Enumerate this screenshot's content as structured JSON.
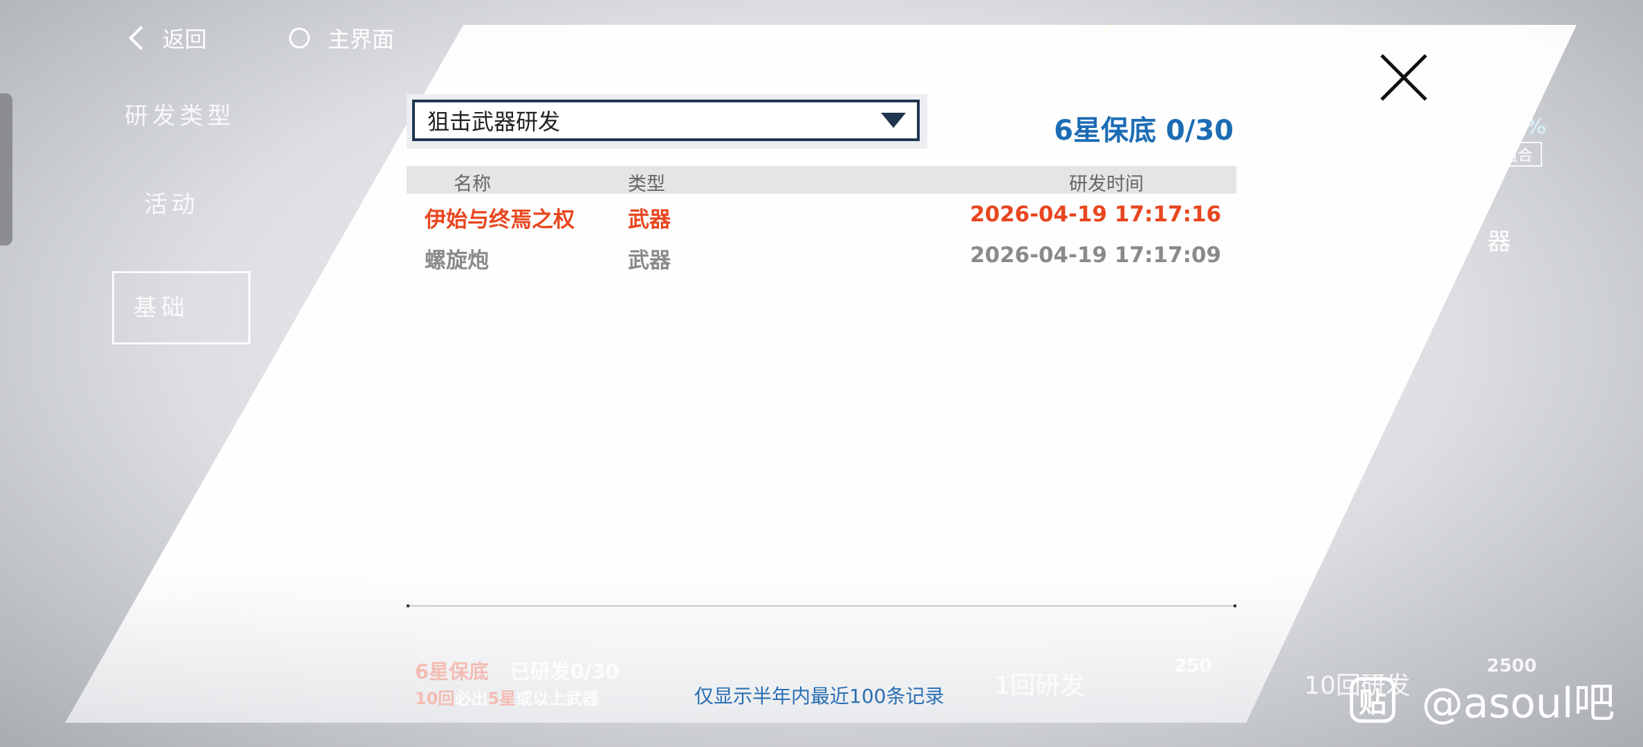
{
  "topbar": {
    "back_label": "返回",
    "home_label": "主界面",
    "resource1": {
      "value": "1620",
      "plus": "+"
    },
    "resource2": {
      "value": "0",
      "plus": "+"
    }
  },
  "background": {
    "left_tabs": [
      "研发类型",
      "活动",
      "基础",
      "独立"
    ],
    "right_rate": "占6星出率80%",
    "switch_label": "切换组合",
    "right_label": "狙击武器",
    "foot_line1_pity": "6星保底",
    "foot_line1_done": "已研发0/30",
    "foot_line2_a": "10回",
    "foot_line2_b": "必出",
    "foot_line2_c": "5星",
    "foot_line2_d": "或以上武器",
    "btn1_label": "1回研发",
    "btn1_cost": "250",
    "btn10_label": "10回研发",
    "btn10_cost": "2500"
  },
  "modal": {
    "dropdown_selected": "狙击武器研发",
    "pity_text": "6星保底 0/30",
    "columns": {
      "name": "名称",
      "type": "类型",
      "time": "研发时间"
    },
    "records": [
      {
        "name": "伊始与终焉之权",
        "type": "武器",
        "time": "2026-04-19 17:17:16",
        "color": "#e8461f"
      },
      {
        "name": "螺旋炮",
        "type": "武器",
        "time": "2026-04-19 17:17:09",
        "color": "#8a8a8a"
      }
    ],
    "footer_note": "仅显示半年内最近100条记录"
  },
  "watermark": {
    "logo_char": "贴",
    "text": "@asoul吧"
  }
}
